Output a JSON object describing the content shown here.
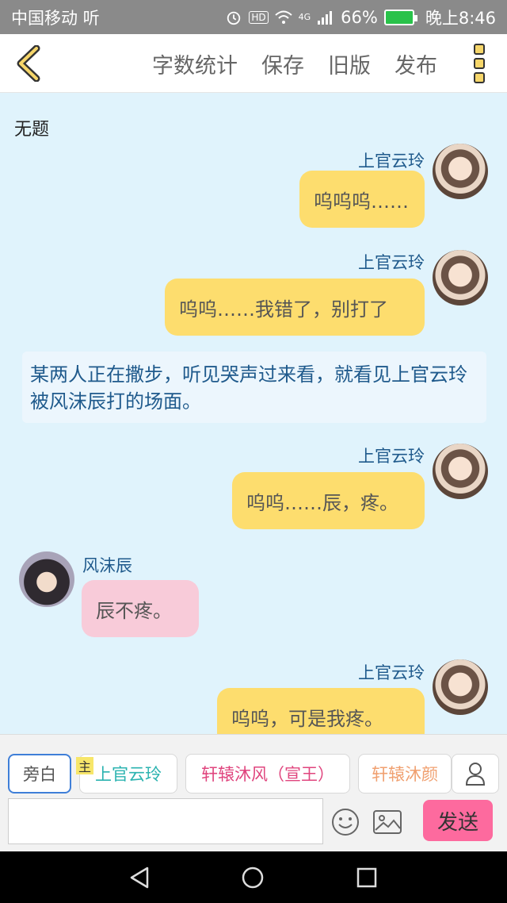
{
  "status": {
    "carrier": "中国移动 听",
    "hd": "HD",
    "net": "4G",
    "battery": "66%",
    "time": "晚上8:46"
  },
  "toolbar": {
    "menu": [
      "字数统计",
      "保存",
      "旧版",
      "发布"
    ]
  },
  "chat": {
    "title": "无题",
    "messages": [
      {
        "speaker": "上官云玲",
        "text": "呜呜呜……"
      },
      {
        "speaker": "上官云玲",
        "text": "呜呜……我错了，别打了"
      },
      {
        "narration": "某两人正在撒步，听见哭声过来看，就看见上官云玲被风沫辰打的场面。"
      },
      {
        "speaker": "上官云玲",
        "text": "呜呜……辰，疼。"
      },
      {
        "speaker": "风沫辰",
        "text": "辰不疼。"
      },
      {
        "speaker": "上官云玲",
        "text": "呜呜，可是我疼。"
      }
    ]
  },
  "bottom": {
    "characters": [
      {
        "label": "旁白",
        "color": "#555555"
      },
      {
        "label": "上官云玲",
        "color": "#2bb3b0"
      },
      {
        "label": "轩辕沐风（宣王）",
        "color": "#e0457e"
      },
      {
        "label": "轩辕沐颜",
        "color": "#f0a070"
      }
    ],
    "host_tag": "主",
    "input_value": "",
    "send_label": "发送"
  }
}
